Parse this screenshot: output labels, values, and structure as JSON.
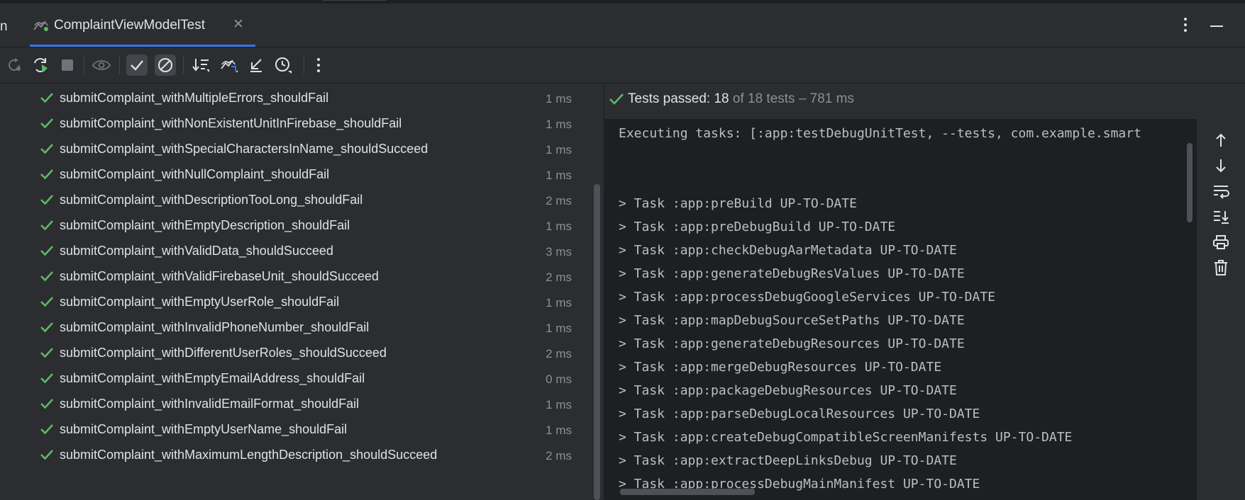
{
  "tab": {
    "partial_label": "n",
    "title": "ComplaintViewModelTest",
    "close_glyph": "✕"
  },
  "colors": {
    "accent": "#3574f0",
    "pass_green": "#5fb865",
    "console_bg": "#1e1f22",
    "panel_bg": "#2b2d30"
  },
  "toolbar": {
    "icons": [
      "rerun-failed-icon",
      "rerun-icon",
      "stop-icon",
      "eye-icon",
      "show-passed-icon",
      "show-ignored-icon",
      "sort-icon",
      "import-tests-icon",
      "collapse-icon",
      "history-icon",
      "more-icon"
    ]
  },
  "tests": [
    {
      "name": "submitComplaint_withMultipleErrors_shouldFail",
      "duration": "1 ms"
    },
    {
      "name": "submitComplaint_withNonExistentUnitInFirebase_shouldFail",
      "duration": "1 ms"
    },
    {
      "name": "submitComplaint_withSpecialCharactersInName_shouldSucceed",
      "duration": "1 ms"
    },
    {
      "name": "submitComplaint_withNullComplaint_shouldFail",
      "duration": "1 ms"
    },
    {
      "name": "submitComplaint_withDescriptionTooLong_shouldFail",
      "duration": "2 ms"
    },
    {
      "name": "submitComplaint_withEmptyDescription_shouldFail",
      "duration": "1 ms"
    },
    {
      "name": "submitComplaint_withValidData_shouldSucceed",
      "duration": "3 ms"
    },
    {
      "name": "submitComplaint_withValidFirebaseUnit_shouldSucceed",
      "duration": "2 ms"
    },
    {
      "name": "submitComplaint_withEmptyUserRole_shouldFail",
      "duration": "1 ms"
    },
    {
      "name": "submitComplaint_withInvalidPhoneNumber_shouldFail",
      "duration": "1 ms"
    },
    {
      "name": "submitComplaint_withDifferentUserRoles_shouldSucceed",
      "duration": "2 ms"
    },
    {
      "name": "submitComplaint_withEmptyEmailAddress_shouldFail",
      "duration": "0 ms"
    },
    {
      "name": "submitComplaint_withInvalidEmailFormat_shouldFail",
      "duration": "1 ms"
    },
    {
      "name": "submitComplaint_withEmptyUserName_shouldFail",
      "duration": "1 ms"
    },
    {
      "name": "submitComplaint_withMaximumLengthDescription_shouldSucceed",
      "duration": "2 ms"
    }
  ],
  "summary": {
    "passed_label": "Tests passed: 18",
    "rest_label": " of 18 tests – 781 ms"
  },
  "console": {
    "lines": [
      "Executing tasks: [:app:testDebugUnitTest, --tests, com.example.smart",
      "",
      "",
      "> Task :app:preBuild UP-TO-DATE",
      "> Task :app:preDebugBuild UP-TO-DATE",
      "> Task :app:checkDebugAarMetadata UP-TO-DATE",
      "> Task :app:generateDebugResValues UP-TO-DATE",
      "> Task :app:processDebugGoogleServices UP-TO-DATE",
      "> Task :app:mapDebugSourceSetPaths UP-TO-DATE",
      "> Task :app:generateDebugResources UP-TO-DATE",
      "> Task :app:mergeDebugResources UP-TO-DATE",
      "> Task :app:packageDebugResources UP-TO-DATE",
      "> Task :app:parseDebugLocalResources UP-TO-DATE",
      "> Task :app:createDebugCompatibleScreenManifests UP-TO-DATE",
      "> Task :app:extractDeepLinksDebug UP-TO-DATE",
      "> Task :app:processDebugMainManifest UP-TO-DATE"
    ]
  },
  "rightbar": {
    "icons": [
      "scroll-up-icon",
      "scroll-down-icon",
      "soft-wrap-icon",
      "scroll-to-end-icon",
      "print-icon",
      "clear-icon"
    ]
  }
}
